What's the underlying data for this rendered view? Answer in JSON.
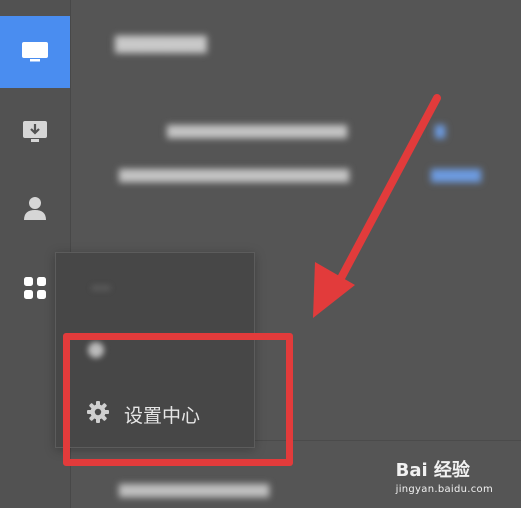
{
  "sidebar": {
    "items": [
      {
        "icon": "monitor-icon",
        "active": true
      },
      {
        "icon": "download-icon",
        "active": false
      },
      {
        "icon": "user-icon",
        "active": false
      },
      {
        "icon": "apps-grid-icon",
        "active": false
      }
    ]
  },
  "popup": {
    "items": [
      {
        "label": "",
        "badge": ""
      },
      {
        "label": "",
        "icon": "circle-icon"
      },
      {
        "label": "设置中心",
        "icon": "gear-icon"
      }
    ]
  },
  "annotation": {
    "color": "#e23b3b"
  },
  "watermark": {
    "logo": "Bai 经验",
    "url": "jingyan.baidu.com"
  },
  "colors": {
    "background": "#555555",
    "sidebar": "#525252",
    "accent": "#4a8df0",
    "popup": "#474747"
  }
}
